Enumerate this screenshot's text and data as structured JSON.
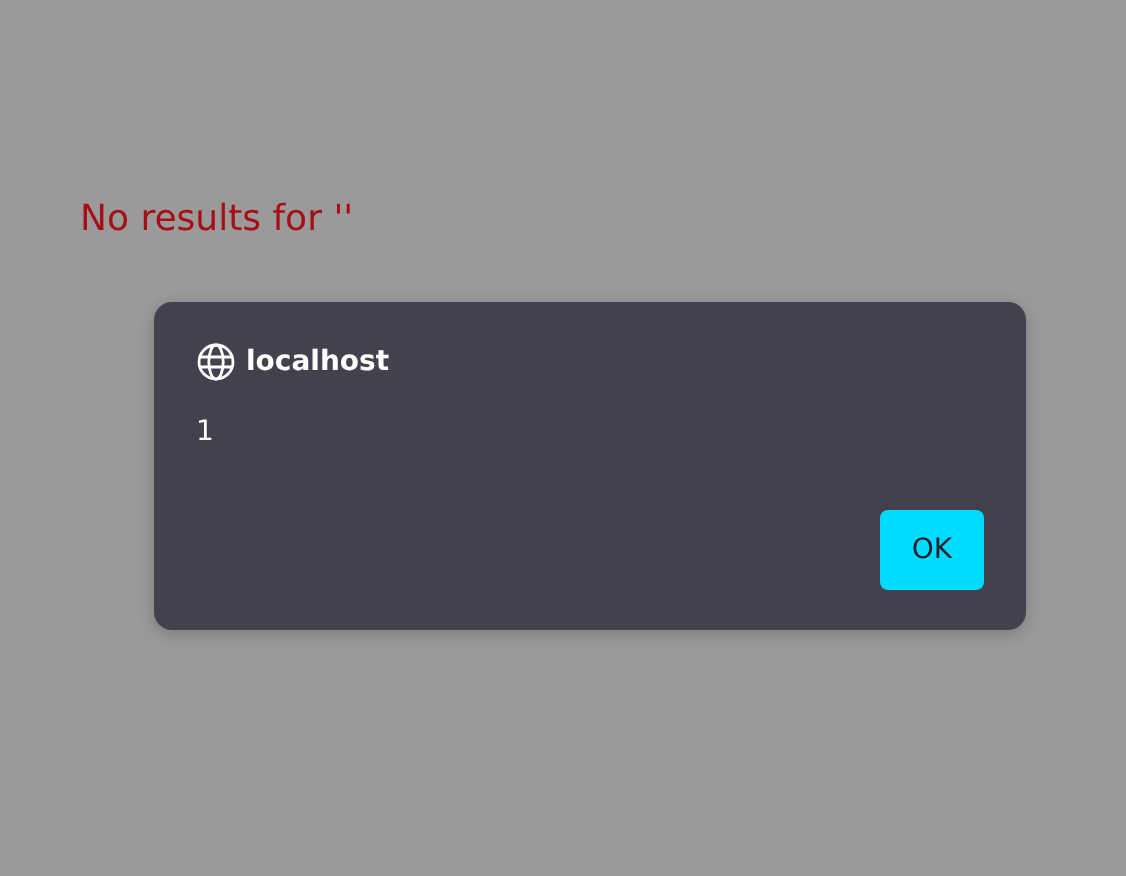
{
  "page": {
    "message": "No results for ''"
  },
  "dialog": {
    "origin": "localhost",
    "text": "1",
    "buttons": [
      "OK"
    ]
  }
}
